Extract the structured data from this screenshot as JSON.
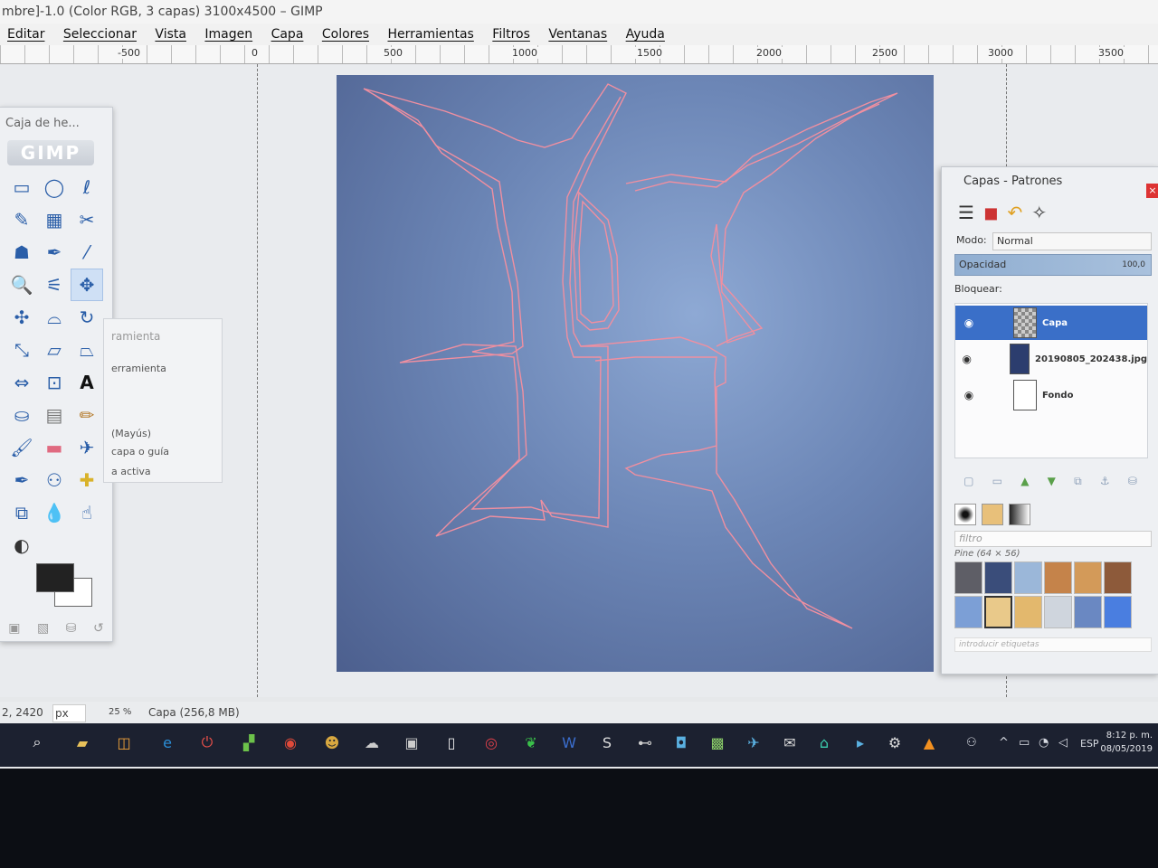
{
  "window": {
    "title": "mbre]-1.0 (Color RGB, 3 capas) 3100x4500 – GIMP"
  },
  "menu": [
    "Editar",
    "Seleccionar",
    "Vista",
    "Imagen",
    "Capa",
    "Colores",
    "Herramientas",
    "Filtros",
    "Ventanas",
    "Ayuda"
  ],
  "ruler": {
    "labels": [
      "-500",
      "0",
      "500",
      "1000",
      "1500",
      "2000",
      "2500",
      "3000",
      "3500"
    ]
  },
  "toolbox": {
    "title": "Caja de he...",
    "tools": [
      {
        "name": "rect-select",
        "glyph": "▭"
      },
      {
        "name": "ellipse-select",
        "glyph": "◯"
      },
      {
        "name": "free-select",
        "glyph": "ℓ"
      },
      {
        "name": "fuzzy-select",
        "glyph": "✎"
      },
      {
        "name": "select-by-color",
        "glyph": "▦"
      },
      {
        "name": "scissors-select",
        "glyph": "✂"
      },
      {
        "name": "foreground-select",
        "glyph": "☗"
      },
      {
        "name": "paths",
        "glyph": "✒"
      },
      {
        "name": "color-picker",
        "glyph": "⁄"
      },
      {
        "name": "zoom",
        "glyph": "🔍"
      },
      {
        "name": "measure",
        "glyph": "⚟"
      },
      {
        "name": "move",
        "glyph": "✥"
      },
      {
        "name": "align",
        "glyph": "✣"
      },
      {
        "name": "crop",
        "glyph": "⌓"
      },
      {
        "name": "rotate",
        "glyph": "↻"
      },
      {
        "name": "scale",
        "glyph": "⤡"
      },
      {
        "name": "shear",
        "glyph": "▱"
      },
      {
        "name": "perspective",
        "glyph": "⏢"
      },
      {
        "name": "flip",
        "glyph": "⇔"
      },
      {
        "name": "cage-transform",
        "glyph": "⊡"
      },
      {
        "name": "text",
        "glyph": "A"
      },
      {
        "name": "bucket-fill",
        "glyph": "⛀"
      },
      {
        "name": "blend",
        "glyph": "▤"
      },
      {
        "name": "pencil",
        "glyph": "✏"
      },
      {
        "name": "paintbrush",
        "glyph": "🖌"
      },
      {
        "name": "eraser",
        "glyph": "▬"
      },
      {
        "name": "airbrush",
        "glyph": "✈"
      },
      {
        "name": "ink",
        "glyph": "✒"
      },
      {
        "name": "clone",
        "glyph": "⚇"
      },
      {
        "name": "healing",
        "glyph": "✚"
      },
      {
        "name": "perspective-clone",
        "glyph": "⧉"
      },
      {
        "name": "blur-sharpen",
        "glyph": "💧"
      },
      {
        "name": "smudge",
        "glyph": "☝"
      },
      {
        "name": "dodge-burn",
        "glyph": "◐"
      }
    ]
  },
  "tool_options": {
    "title": "ramienta",
    "line1": "erramienta",
    "line2": "(Mayús)",
    "line3": "capa o guía",
    "line4": "a activa"
  },
  "docks": {
    "title": "Capas - Patrones",
    "mode_label": "Modo:",
    "mode_value": "Normal",
    "opacity_label": "Opacidad",
    "opacity_value": "100,0",
    "lock_label": "Bloquear:",
    "layers": [
      {
        "name": "Capa",
        "selected": true
      },
      {
        "name": "20190805_202438.jpg",
        "selected": false
      },
      {
        "name": "Fondo",
        "selected": false
      }
    ],
    "filter_placeholder": "filtro",
    "pattern_name": "Pine (64 × 56)",
    "tags_placeholder": "introducir etiquetas"
  },
  "statusbar": {
    "coords": "2, 2420",
    "unit": "px",
    "zoom": "25 %",
    "info": "Capa (256,8 MB)"
  },
  "taskbar": {
    "lang": "ESP",
    "time": "8:12 p. m.",
    "date": "08/05/2019"
  },
  "colors": {
    "accent": "#3a6fc8",
    "taskbar": "#1c2130"
  }
}
